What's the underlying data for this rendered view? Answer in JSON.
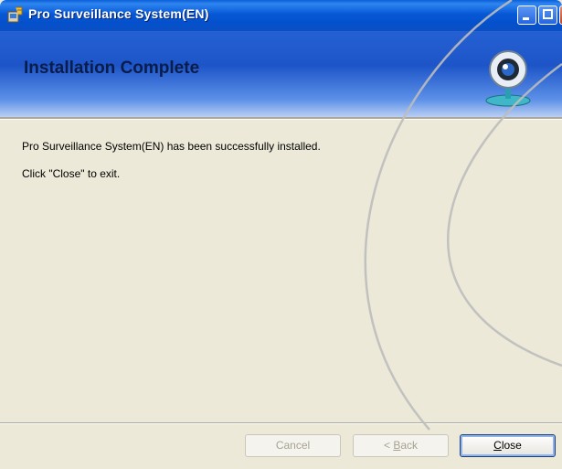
{
  "window": {
    "title": "Pro Surveillance System(EN)"
  },
  "banner": {
    "title": "Installation Complete"
  },
  "content": {
    "line1": "Pro Surveillance System(EN) has been successfully installed.",
    "line2": "Click \"Close\" to exit."
  },
  "buttons": {
    "cancel": {
      "label": "Cancel",
      "enabled": false
    },
    "back": {
      "prefix": "< ",
      "mnemonic": "B",
      "rest": "ack",
      "enabled": false
    },
    "close": {
      "mnemonic": "C",
      "rest": "lose",
      "enabled": true
    }
  },
  "icons": {
    "app": "installer-icon",
    "webcam": "webcam-icon"
  },
  "colors": {
    "titlebar": "#0758d6",
    "banner": "#1d55c8",
    "dialog_bg": "#ece9d8"
  }
}
